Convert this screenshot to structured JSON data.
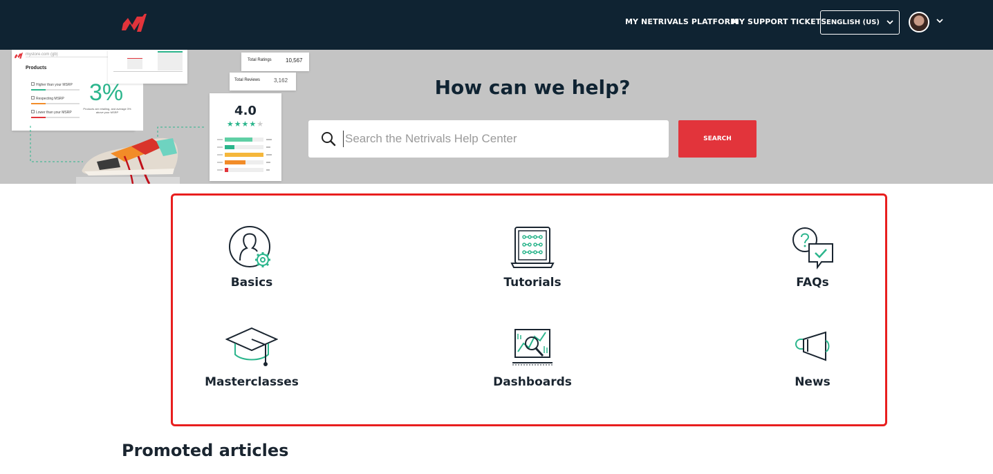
{
  "header": {
    "nav": [
      "MY NETRIVALS PLATFORM",
      "MY SUPPORT TICKETS"
    ],
    "language": "ENGLISH (US)"
  },
  "hero": {
    "title": "How can we help?",
    "search_placeholder": "Search the Netrivals Help Center",
    "search_button": "SEARCH",
    "illustration": {
      "store": "mystore.com (gb)",
      "products_label": "Products",
      "price_rows": [
        "Higher than your MSRP",
        "Respecting MSRP",
        "Lower than your MSRP"
      ],
      "percent": "3%",
      "percent_caption": "Products are retailing, and average 3% above your MSRP",
      "total_ratings_label": "Total Ratings",
      "total_ratings": "10,567",
      "total_reviews_label": "Total Reviews",
      "total_reviews": "3,162",
      "rating": "4.0",
      "stars": 4
    }
  },
  "categories": [
    {
      "label": "Basics",
      "icon": "user-gear-icon"
    },
    {
      "label": "Tutorials",
      "icon": "laptop-icon"
    },
    {
      "label": "FAQs",
      "icon": "question-chat-icon"
    },
    {
      "label": "Masterclasses",
      "icon": "graduation-cap-icon"
    },
    {
      "label": "Dashboards",
      "icon": "dashboard-monitor-icon"
    },
    {
      "label": "News",
      "icon": "megaphone-icon"
    }
  ],
  "promoted_title": "Promoted articles",
  "colors": {
    "header_bg": "#0f2332",
    "hero_bg": "#c4c4c4",
    "accent_red": "#e2343b",
    "icon_green": "#2bb58c",
    "highlight": "#e81e1e"
  }
}
